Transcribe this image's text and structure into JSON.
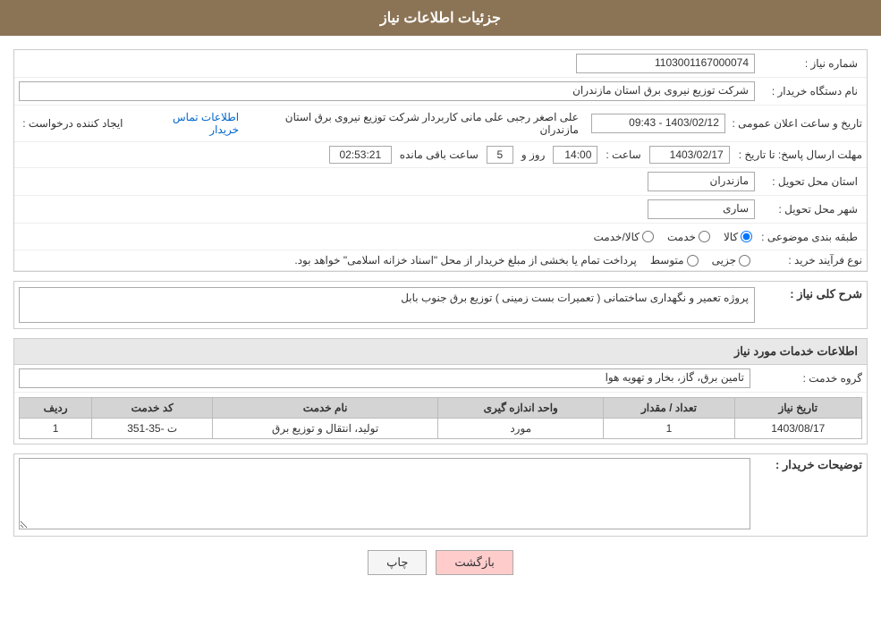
{
  "header": {
    "title": "جزئیات اطلاعات نیاز"
  },
  "form": {
    "need_number_label": "شماره نیاز :",
    "need_number_value": "1103001167000074",
    "buyer_org_label": "نام دستگاه خریدار :",
    "buyer_org_value": "شرکت توزیع نیروی برق استان مازندران",
    "announce_label": "تاریخ و ساعت اعلان عمومی :",
    "announce_value": "1403/02/12 - 09:43",
    "creator_label": "ایجاد کننده درخواست :",
    "creator_value": "علی اصغر رجبی علی مانی کاربردار شرکت توزیع نیروی برق استان مازندران",
    "contact_link": "اطلاعات تماس خریدار",
    "deadline_label": "مهلت ارسال پاسخ: تا تاریخ :",
    "deadline_date": "1403/02/17",
    "deadline_time_label": "ساعت :",
    "deadline_time": "14:00",
    "deadline_days_label": "روز و",
    "deadline_days": "5",
    "deadline_remaining_label": "ساعت باقی مانده",
    "deadline_remaining": "02:53:21",
    "province_label": "استان محل تحویل :",
    "province_value": "مازندران",
    "city_label": "شهر محل تحویل :",
    "city_value": "ساری",
    "category_label": "طبقه بندی موضوعی :",
    "category_radio1": "کالا",
    "category_radio2": "خدمت",
    "category_radio3": "کالا/خدمت",
    "category_selected": "کالا",
    "purchase_type_label": "نوع فرآیند خرید :",
    "purchase_type_radio1": "جزیی",
    "purchase_type_radio2": "متوسط",
    "purchase_type_note": "پرداخت تمام یا بخشی از مبلغ خریدار از محل \"اسناد خزانه اسلامی\" خواهد بود.",
    "need_desc_label": "شرح کلی نیاز :",
    "need_desc_value": "پروژه تعمیر و نگهداری ساختمانی ( تعمیرات بست زمینی ) توزیع برق جنوب بابل",
    "services_section_title": "اطلاعات خدمات مورد نیاز",
    "service_group_label": "گروه خدمت :",
    "service_group_value": "تامین برق، گاز، بخار و تهویه هوا",
    "table": {
      "col_row": "ردیف",
      "col_code": "کد خدمت",
      "col_name": "نام خدمت",
      "col_unit": "واحد اندازه گیری",
      "col_qty": "تعداد / مقدار",
      "col_date": "تاریخ نیاز",
      "rows": [
        {
          "row": "1",
          "code": "ت -35-351",
          "name": "تولید، انتقال و توزیع برق",
          "unit": "مورد",
          "qty": "1",
          "date": "1403/08/17"
        }
      ]
    },
    "buyer_desc_label": "توضیحات خریدار :",
    "buyer_desc_value": "",
    "btn_print": "چاپ",
    "btn_back": "بازگشت"
  }
}
